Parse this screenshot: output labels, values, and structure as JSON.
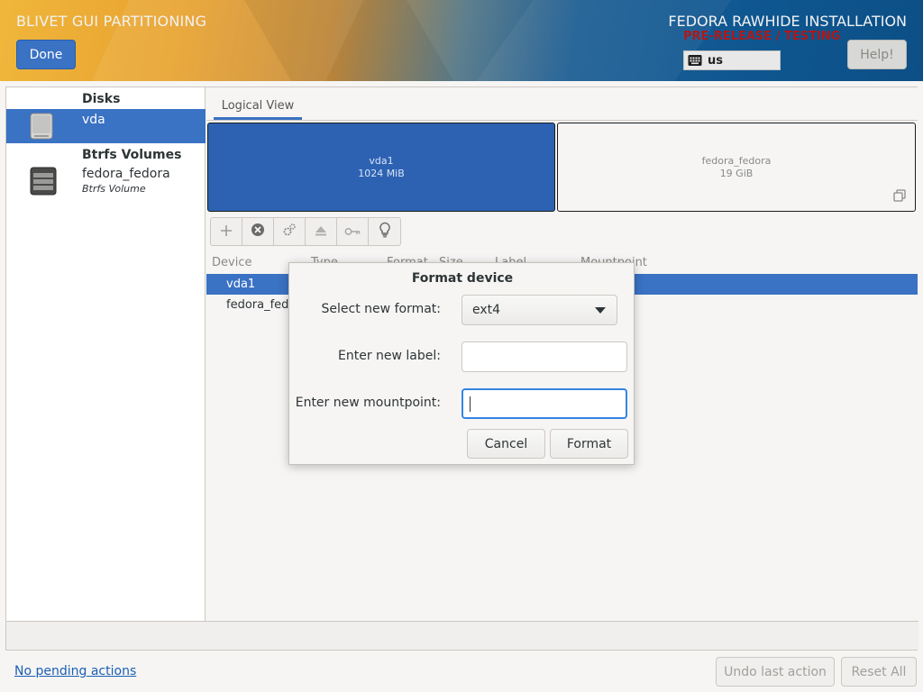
{
  "header": {
    "app_title": "BLIVET GUI PARTITIONING",
    "done_label": "Done",
    "install_title": "FEDORA RAWHIDE INSTALLATION",
    "prerelease": "PRE-RELEASE / TESTING",
    "keyboard_layout": "us",
    "help_label": "Help!"
  },
  "sidebar": {
    "disks_header": "Disks",
    "disks": [
      {
        "name": "vda",
        "selected": true
      }
    ],
    "btrfs_header": "Btrfs Volumes",
    "btrfs": [
      {
        "name": "fedora_fedora",
        "subtitle": "Btrfs Volume"
      }
    ]
  },
  "content": {
    "tab_label": "Logical View",
    "blocks": [
      {
        "name": "vda1",
        "size": "1024 MiB",
        "selected": true
      },
      {
        "name": "fedora_fedora",
        "size": "19 GiB",
        "selected": false
      }
    ],
    "toolbar": [
      "add-icon",
      "delete-icon",
      "settings-icon",
      "unmount-icon",
      "decrypt-icon",
      "info-icon"
    ],
    "columns": [
      "Device",
      "Type",
      "Format",
      "Size",
      "Label",
      "Mountpoint"
    ],
    "rows": [
      {
        "device": "vda1",
        "selected": true
      },
      {
        "device": "fedora_fed.",
        "selected": false
      }
    ]
  },
  "bottom": {
    "pending_actions": "No pending actions",
    "undo_label": "Undo last action",
    "reset_label": "Reset All"
  },
  "dialog": {
    "title": "Format device",
    "format_label": "Select new format:",
    "format_value": "ext4",
    "label_label": "Enter new label:",
    "label_value": "",
    "mountpoint_label": "Enter new mountpoint:",
    "mountpoint_value": "",
    "cancel_label": "Cancel",
    "format_button": "Format"
  },
  "colors": {
    "accent": "#3a72c4",
    "selected_block": "#2d62b3",
    "prerelease": "#b01818",
    "focus": "#3584e4"
  }
}
